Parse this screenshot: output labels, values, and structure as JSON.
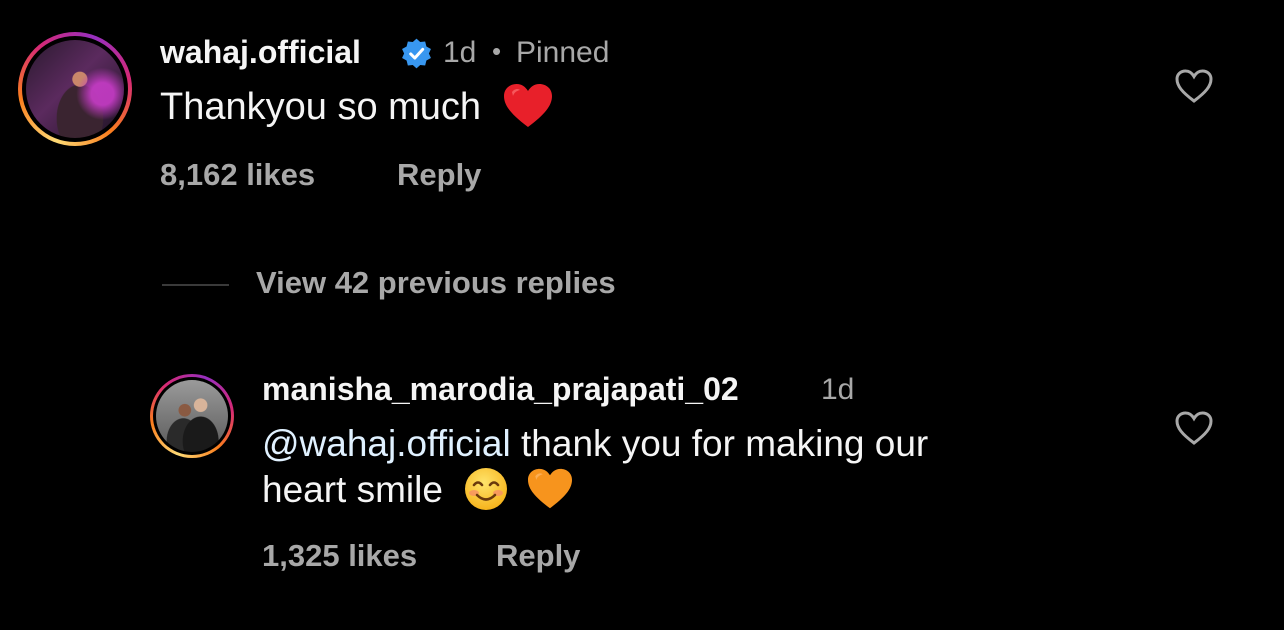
{
  "comments": [
    {
      "username": "wahaj.official",
      "verified": true,
      "time": "1d",
      "separator": "•",
      "pinned_label": "Pinned",
      "text": "Thankyou so much",
      "emoji": "red-heart-emoji",
      "likes": "8,162 likes",
      "reply_label": "Reply"
    },
    {
      "username": "manisha_marodia_prajapati_02",
      "time": "1d",
      "mention": "@wahaj.official",
      "text_line1": " thank you for making our",
      "text_line2": "heart smile",
      "emojis": [
        "smiling-face-emoji",
        "orange-heart-emoji"
      ],
      "likes": "1,325 likes",
      "reply_label": "Reply"
    }
  ],
  "view_replies_label": "View 42 previous replies",
  "colors": {
    "background": "#000000",
    "primary_text": "#f5f5f5",
    "secondary_text": "#a8a8a8",
    "mention": "#e0f1ff",
    "verified_badge": "#3897f0"
  }
}
